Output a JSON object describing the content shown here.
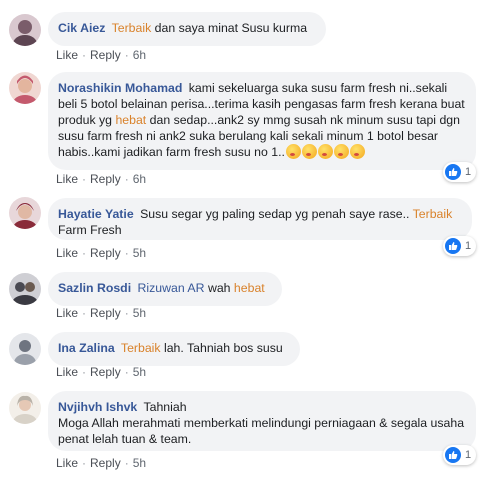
{
  "actions": {
    "like": "Like",
    "reply": "Reply",
    "sep": "·"
  },
  "comments": [
    {
      "author": "Cik Aiez",
      "tag": "Terbaik",
      "text_after": "dan saya minat Susu kurma",
      "time": "6h",
      "avatar_color": "#7a5c6a"
    },
    {
      "author": "Norashikin Mohamad",
      "text_1": "kami sekeluarga suka susu farm fresh ni..sekali beli 5 botol belainan perisa...terima kasih pengasas farm fresh kerana buat produk yg",
      "tag": "hebat",
      "text_2": "dan sedap...ank2 sy mmg susah nk minum susu tapi dgn susu farm fresh ni ank2 suka berulang kali sekali minum 1 botol besar habis..kami jadikan farm fresh susu no 1..",
      "time": "6h",
      "reaction_count": "1",
      "avatar_color": "#c45a6d"
    },
    {
      "author": "Hayatie Yatie",
      "text_1": "Susu segar yg paling sedap yg penah saye rase..",
      "tag": "Terbaik",
      "text_2": "Farm Fresh",
      "time": "5h",
      "reaction_count": "1",
      "avatar_color": "#8a2b3a"
    },
    {
      "author": "Sazlin Rosdi",
      "mention": "Rizuwan AR",
      "text_1": "wah",
      "tag": "hebat",
      "time": "5h",
      "avatar_color": "#4a4a52"
    },
    {
      "author": "Ina Zalina",
      "tag": "Terbaik",
      "text_after": "lah. Tahniah bos susu",
      "time": "5h",
      "avatar_color": "#6e7480"
    },
    {
      "author": "Nvjihvh Ishvk",
      "text_1": "Tahniah",
      "text_2": "Moga Allah merahmati memberkati melindungi perniagaan & segala usaha penat lelah tuan & team.",
      "time": "5h",
      "reaction_count": "1",
      "avatar_color": "#b9b2a8"
    }
  ]
}
